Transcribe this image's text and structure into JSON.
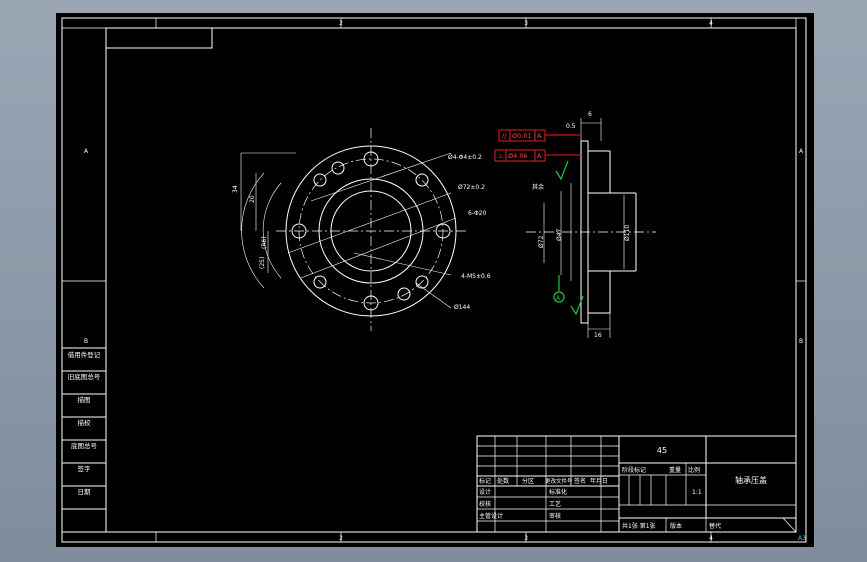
{
  "frame": {
    "top_zones": [
      "2",
      "3",
      "4"
    ],
    "bottom_zones": [
      "2",
      "3",
      "4"
    ],
    "left_zones": [
      "A",
      "B"
    ],
    "right_zones": [
      "A",
      "B"
    ]
  },
  "left_labels": [
    "借用件登记",
    "旧底图总号",
    "底图总号",
    "签字",
    "日期"
  ],
  "left_labels_extra": [
    "描图",
    "描校"
  ],
  "dims_front": {
    "d1": "Ø4-Φ4±0.2",
    "d2": "Ø72±0.2",
    "d3": "6-Φ20",
    "d4": "4-M5±0.6",
    "d5": "Ø144",
    "d6": "34",
    "d7": "20",
    "d8": "(R6)",
    "d9": "(25)"
  },
  "tolerance_frames": [
    {
      "sym": "//",
      "val": "Ø0.01",
      "ref": "A"
    },
    {
      "sym": "⊥",
      "val": "Ø4.06",
      "ref": "A"
    }
  ],
  "dims_side": {
    "thickness": "6",
    "step": "0.5",
    "left_mark": "其余",
    "bore": "Ø72",
    "outer": "Ø47",
    "flange": "Ø110",
    "bottom": "16",
    "datum": "A"
  },
  "title_block": {
    "material": "45",
    "part_name": "轴承压盖",
    "scale": "1:1",
    "sheet_info": "共1张 第1张",
    "version": "版本",
    "replace": "替代",
    "headers": [
      "标记",
      "处数",
      "分区",
      "更改文件号",
      "签名",
      "年月日"
    ],
    "roles": [
      "设计",
      "校核",
      "主管设计"
    ],
    "roles2": [
      "标准化",
      "工艺",
      "审核"
    ],
    "stage_headers": [
      "阶段标记",
      "重量",
      "比例"
    ],
    "sheet_code": "A3"
  }
}
